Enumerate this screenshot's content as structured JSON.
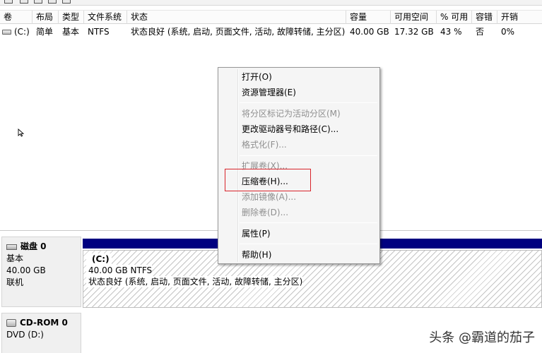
{
  "columns": [
    "卷",
    "布局",
    "类型",
    "文件系统",
    "状态",
    "容量",
    "可用空间",
    "% 可用",
    "容错",
    "开销"
  ],
  "volumes": [
    {
      "volume": "(C:)",
      "layout": "简单",
      "type": "基本",
      "filesystem": "NTFS",
      "status": "状态良好 (系统, 启动, 页面文件, 活动, 故障转储, 主分区)",
      "capacity": "40.00 GB",
      "free": "17.32 GB",
      "pct_free": "43 %",
      "fault_tolerance": "否",
      "overhead": "0%"
    }
  ],
  "disk0": {
    "title": "磁盘 0",
    "type": "基本",
    "size": "40.00 GB",
    "state": "联机",
    "partition": {
      "label": "(C:)",
      "size_fs": "40.00 GB NTFS",
      "status": "状态良好 (系统, 启动, 页面文件, 活动, 故障转储, 主分区)"
    }
  },
  "cdrom": {
    "title": "CD-ROM 0",
    "type": "DVD (D:)"
  },
  "context_menu": {
    "items": [
      {
        "label": "打开(O)",
        "enabled": true
      },
      {
        "label": "资源管理器(E)",
        "enabled": true
      },
      {
        "label": "将分区标记为活动分区(M)",
        "enabled": false
      },
      {
        "label": "更改驱动器号和路径(C)...",
        "enabled": true
      },
      {
        "label": "格式化(F)...",
        "enabled": false
      },
      {
        "label": "扩展卷(X)...",
        "enabled": false
      },
      {
        "label": "压缩卷(H)...",
        "enabled": true,
        "highlighted": true
      },
      {
        "label": "添加镜像(A)...",
        "enabled": false
      },
      {
        "label": "删除卷(D)...",
        "enabled": false
      },
      {
        "label": "属性(P)",
        "enabled": true
      },
      {
        "label": "帮助(H)",
        "enabled": true
      }
    ]
  },
  "watermark": "头条 @霸道的茄子",
  "colors": {
    "partition_bar": "#000080",
    "highlight_box": "#d8232a"
  }
}
